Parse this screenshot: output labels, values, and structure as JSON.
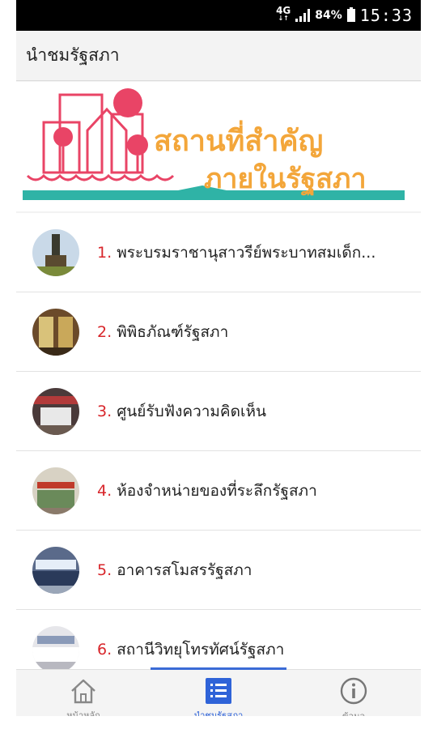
{
  "status_bar": {
    "network": "4G",
    "battery_percent": "84%",
    "time": "15:33"
  },
  "app_bar": {
    "title": "นำชมรัฐสภา"
  },
  "banner": {
    "line1": "สถานที่สำคัญ",
    "line2": "ภายในรัฐสภา",
    "colors": {
      "pink": "#e94466",
      "orange": "#f3a63a",
      "teal": "#2fb3a6"
    }
  },
  "places": [
    {
      "number": "1.",
      "label": "พระบรมราชานุสาวรีย์พระบาทสมเด็ก...",
      "icon": "monument-thumbnail"
    },
    {
      "number": "2.",
      "label": "พิพิธภัณฑ์รัฐสภา",
      "icon": "museum-thumbnail"
    },
    {
      "number": "3.",
      "label": "ศูนย์รับฟังความคิดเห็น",
      "icon": "opinion-center-thumbnail"
    },
    {
      "number": "4.",
      "label": "ห้องจำหน่ายของที่ระลึกรัฐสภา",
      "icon": "souvenir-shop-thumbnail"
    },
    {
      "number": "5.",
      "label": "อาคารสโมสรรัฐสภา",
      "icon": "club-building-thumbnail"
    },
    {
      "number": "6.",
      "label": "สถานีวิทยุโทรทัศน์รัฐสภา",
      "icon": "tv-station-thumbnail"
    }
  ],
  "bottom_nav": {
    "tabs": [
      {
        "label": "หน้าหลัก",
        "icon": "home-icon",
        "active": false
      },
      {
        "label": "นำชมรัฐสภา",
        "icon": "list-icon",
        "active": true
      },
      {
        "label": "ข้อมูล",
        "icon": "info-icon",
        "active": false
      }
    ],
    "active_color": "#2f63d8"
  }
}
